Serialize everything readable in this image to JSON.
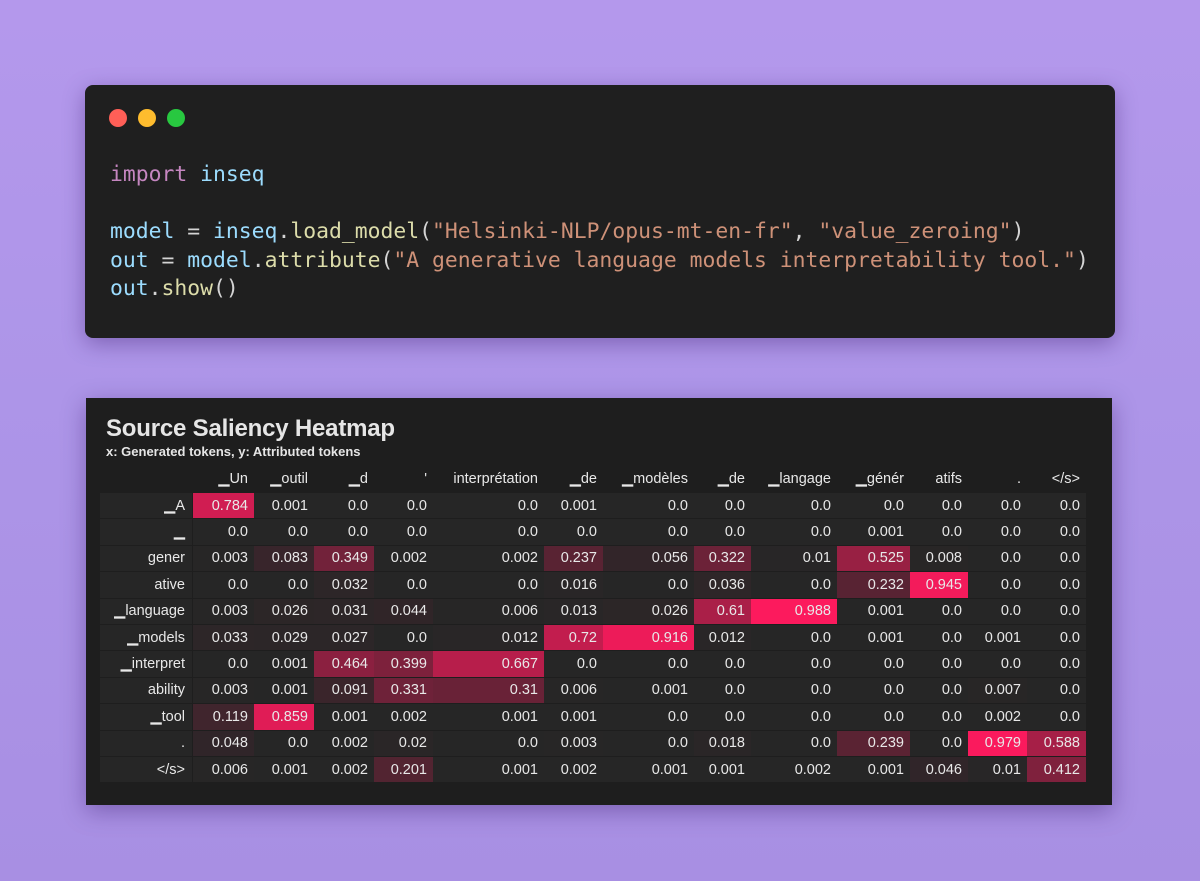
{
  "code_window": {
    "buttons": {
      "close_color": "#ff5f57",
      "minimize_color": "#febc2e",
      "zoom_color": "#28c840"
    },
    "lines": [
      [
        {
          "t": "import",
          "c": "kw"
        },
        {
          "t": " ",
          "c": "op"
        },
        {
          "t": "inseq",
          "c": "var"
        }
      ],
      [],
      [
        {
          "t": "model",
          "c": "var"
        },
        {
          "t": " = ",
          "c": "op"
        },
        {
          "t": "inseq",
          "c": "var"
        },
        {
          "t": ".",
          "c": "op"
        },
        {
          "t": "load_model",
          "c": "fn"
        },
        {
          "t": "(",
          "c": "op"
        },
        {
          "t": "\"Helsinki-NLP/opus-mt-en-fr\"",
          "c": "str"
        },
        {
          "t": ", ",
          "c": "op"
        },
        {
          "t": "\"value_zeroing\"",
          "c": "str"
        },
        {
          "t": ")",
          "c": "op"
        }
      ],
      [
        {
          "t": "out",
          "c": "var"
        },
        {
          "t": " = ",
          "c": "op"
        },
        {
          "t": "model",
          "c": "var"
        },
        {
          "t": ".",
          "c": "op"
        },
        {
          "t": "attribute",
          "c": "fn"
        },
        {
          "t": "(",
          "c": "op"
        },
        {
          "t": "\"A generative language models interpretability tool.\"",
          "c": "str"
        },
        {
          "t": ")",
          "c": "op"
        }
      ],
      [
        {
          "t": "out",
          "c": "var"
        },
        {
          "t": ".",
          "c": "op"
        },
        {
          "t": "show",
          "c": "fn"
        },
        {
          "t": "()",
          "c": "op"
        }
      ]
    ]
  },
  "heatmap": {
    "title": "Source Saliency Heatmap",
    "subtitle": "x: Generated tokens, y: Attributed tokens",
    "colors": {
      "empty": "#262626",
      "max": "#ff1a5e"
    },
    "chart_data": {
      "type": "heatmap",
      "x": [
        "▁Un",
        "▁outil",
        "▁d",
        "'",
        "interprétation",
        "▁de",
        "▁modèles",
        "▁de",
        "▁langage",
        "▁génér",
        "atifs",
        ".",
        "</s>"
      ],
      "y": [
        "▁A",
        "▁",
        "gener",
        "ative",
        "▁language",
        "▁models",
        "▁interpret",
        "ability",
        "▁tool",
        ".",
        "</s>"
      ],
      "values": [
        [
          "0.784",
          "0.001",
          "0.0",
          "0.0",
          "0.0",
          "0.001",
          "0.0",
          "0.0",
          "0.0",
          "0.0",
          "0.0",
          "0.0",
          "0.0"
        ],
        [
          "0.0",
          "0.0",
          "0.0",
          "0.0",
          "0.0",
          "0.0",
          "0.0",
          "0.0",
          "0.0",
          "0.001",
          "0.0",
          "0.0",
          "0.0"
        ],
        [
          "0.003",
          "0.083",
          "0.349",
          "0.002",
          "0.002",
          "0.237",
          "0.056",
          "0.322",
          "0.01",
          "0.525",
          "0.008",
          "0.0",
          "0.0"
        ],
        [
          "0.0",
          "0.0",
          "0.032",
          "0.0",
          "0.0",
          "0.016",
          "0.0",
          "0.036",
          "0.0",
          "0.232",
          "0.945",
          "0.0",
          "0.0"
        ],
        [
          "0.003",
          "0.026",
          "0.031",
          "0.044",
          "0.006",
          "0.013",
          "0.026",
          "0.61",
          "0.988",
          "0.001",
          "0.0",
          "0.0",
          "0.0"
        ],
        [
          "0.033",
          "0.029",
          "0.027",
          "0.0",
          "0.012",
          "0.72",
          "0.916",
          "0.012",
          "0.0",
          "0.001",
          "0.0",
          "0.001",
          "0.0"
        ],
        [
          "0.0",
          "0.001",
          "0.464",
          "0.399",
          "0.667",
          "0.0",
          "0.0",
          "0.0",
          "0.0",
          "0.0",
          "0.0",
          "0.0",
          "0.0"
        ],
        [
          "0.003",
          "0.001",
          "0.091",
          "0.331",
          "0.31",
          "0.006",
          "0.001",
          "0.0",
          "0.0",
          "0.0",
          "0.0",
          "0.007",
          "0.0"
        ],
        [
          "0.119",
          "0.859",
          "0.001",
          "0.002",
          "0.001",
          "0.001",
          "0.0",
          "0.0",
          "0.0",
          "0.0",
          "0.0",
          "0.002",
          "0.0"
        ],
        [
          "0.048",
          "0.0",
          "0.002",
          "0.02",
          "0.0",
          "0.003",
          "0.0",
          "0.018",
          "0.0",
          "0.239",
          "0.0",
          "0.979",
          "0.588"
        ],
        [
          "0.006",
          "0.001",
          "0.002",
          "0.201",
          "0.001",
          "0.002",
          "0.001",
          "0.001",
          "0.002",
          "0.001",
          "0.046",
          "0.01",
          "0.412"
        ]
      ],
      "value_range": [
        0,
        1
      ]
    }
  }
}
